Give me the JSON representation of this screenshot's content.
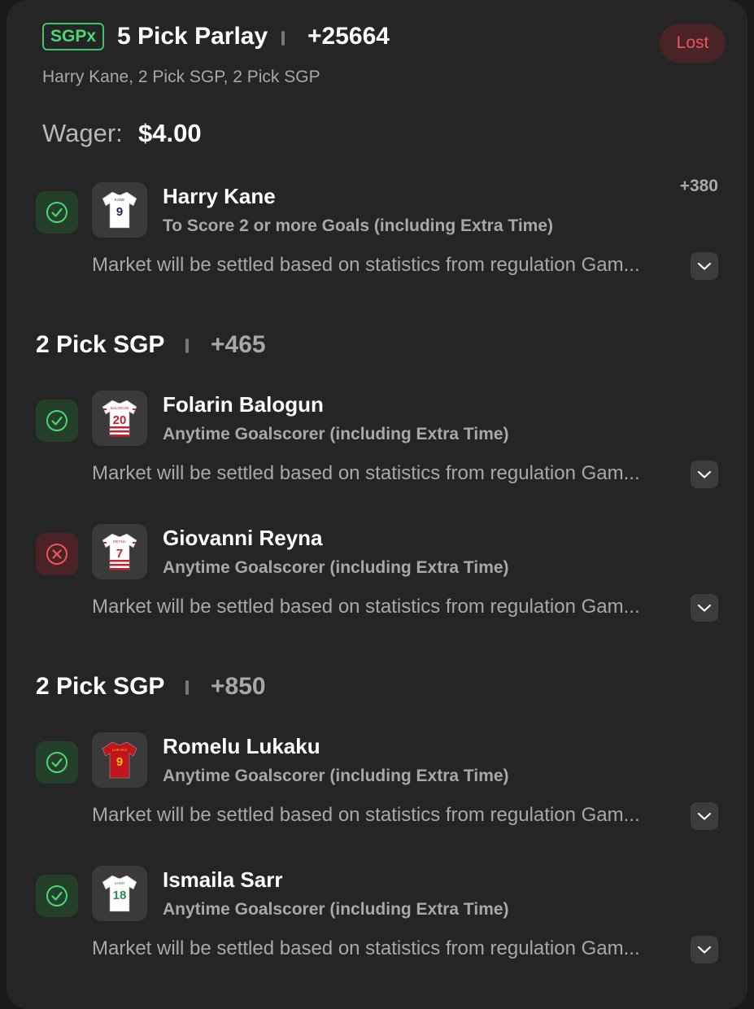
{
  "header": {
    "badge": "SGPx",
    "title": "5 Pick Parlay",
    "odds": "+25664",
    "status": "Lost",
    "subtitle": "Harry Kane, 2 Pick SGP, 2 Pick SGP"
  },
  "wager": {
    "label": "Wager:",
    "value": "$4.00"
  },
  "picks": [
    {
      "player": "Harry Kane",
      "market": "To Score 2 or more Goals (including Extra Time)",
      "note": "Market will be settled based on statistics from regulation Gam...",
      "odds": "+380",
      "result": "won",
      "jersey": {
        "number": "9",
        "name": "KANE",
        "color": "#ffffff",
        "accent": "#1e2a4a",
        "stripes": false
      }
    }
  ],
  "sections": [
    {
      "name": "2 Pick SGP",
      "odds": "+465",
      "picks": [
        {
          "player": "Folarin Balogun",
          "market": "Anytime Goalscorer (including Extra Time)",
          "note": "Market will be settled based on statistics from regulation Gam...",
          "result": "won",
          "jersey": {
            "number": "20",
            "name": "BALOGUN",
            "color": "#ffffff",
            "accent": "#c8202f",
            "stripes": true
          }
        },
        {
          "player": "Giovanni Reyna",
          "market": "Anytime Goalscorer (including Extra Time)",
          "note": "Market will be settled based on statistics from regulation Gam...",
          "result": "lost",
          "jersey": {
            "number": "7",
            "name": "REYNA",
            "color": "#ffffff",
            "accent": "#c8202f",
            "stripes": true
          }
        }
      ]
    },
    {
      "name": "2 Pick SGP",
      "odds": "+850",
      "picks": [
        {
          "player": "Romelu Lukaku",
          "market": "Anytime Goalscorer (including Extra Time)",
          "note": "Market will be settled based on statistics from regulation Gam...",
          "result": "won",
          "jersey": {
            "number": "9",
            "name": "LUKAKU",
            "color": "#c0151c",
            "accent": "#f2c200",
            "stripes": false
          }
        },
        {
          "player": "Ismaila Sarr",
          "market": "Anytime Goalscorer (including Extra Time)",
          "note": "Market will be settled based on statistics from regulation Gam...",
          "result": "won",
          "jersey": {
            "number": "18",
            "name": "SARR",
            "color": "#ffffff",
            "accent": "#2f8a56",
            "stripes": false
          }
        }
      ]
    }
  ],
  "icons": {
    "won": "check-circle-icon",
    "lost": "x-circle-icon",
    "expand": "chevron-down-icon",
    "jersey": "jersey-icon"
  },
  "colors": {
    "won": "#4ad777",
    "lost": "#f0535e",
    "card": "#252525"
  }
}
